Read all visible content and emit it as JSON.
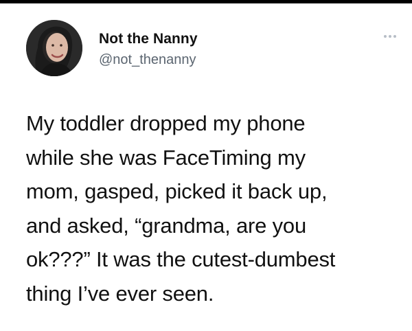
{
  "tweet": {
    "display_name": "Not the Nanny",
    "handle": "@not_thenanny",
    "text": "My toddler dropped my phone\nwhile she was FaceTiming my\nmom, gasped, picked it back up,\nand asked, “grandma, are you\nok???” It was the cutest-dumbest\nthing I’ve ever seen.",
    "more_icon": "ellipsis-icon",
    "avatar_icon": "profile-photo"
  }
}
